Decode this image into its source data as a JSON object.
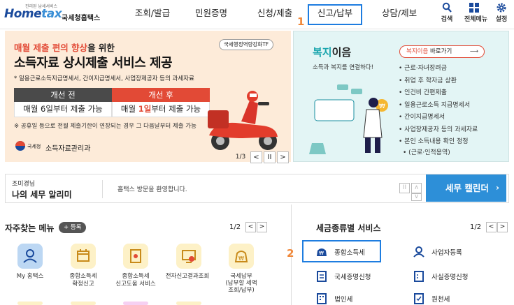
{
  "header": {
    "logo_tagline": "진리된 납세서비스",
    "logo_text_a": "Home",
    "logo_text_b": "tax",
    "logo_kr": "국세청홈택스",
    "nav": [
      "조회/발급",
      "민원증명",
      "신청/제출",
      "신고/납부",
      "상담/제보"
    ],
    "annotation_1": "1",
    "tools": [
      "검색",
      "전체메뉴",
      "설정"
    ]
  },
  "banner": {
    "subtitle_pre": "매월 제출 편의 향상",
    "subtitle_post": "을 위한",
    "title": "소득자료 상시제출 서비스 제공",
    "note": "* 일용근로소득지급명세서, 간이지급명세서, 사업장제공자 등의 과세자료",
    "badge": "국세행정역량강화TF",
    "before_label": "개선 전",
    "before_value": "매월 6일부터 제출 가능",
    "after_label": "개선 후",
    "after_value_pre": "매월 ",
    "after_value_hl": "1일",
    "after_value_post": "부터 제출 가능",
    "footnote": "※ 공휴일 등으로 전월 제출기한이 연장되는 경우 그 다음날부터 제출 가능",
    "org_logo": "국세청",
    "org": "소득자료관리과",
    "page": "1/3",
    "pager_prev": "<",
    "pager_pause": "II",
    "pager_next": ">"
  },
  "welfare": {
    "title_a": "복지",
    "title_b": "이음",
    "subtitle": "소득과 복지를 연결하다!",
    "button_a": "복지이음",
    "button_b": " 바로가기",
    "items": [
      "근로·자녀장려금",
      "취업 후 학자금 상환",
      "인건비 간편제출",
      "일용근로소득 지급명세서",
      "간이지급명세서",
      "사업장제공자 등의 과세자료",
      "본인 소득내용 확인 정정",
      "(근로·인적용역)"
    ]
  },
  "bulletin": {
    "greeting": "조미경님",
    "title": "나의 세무 알리미",
    "message": "홈택스 방문을 환영합니다.",
    "calendar_btn": "세무 캘린더"
  },
  "fav": {
    "title": "자주찾는 메뉴",
    "add_btn": "+ 등록",
    "page": "1/2",
    "items": [
      "My 홈택스",
      "종합소득세\n확정신고",
      "종합소득세\n신고도움 서비스",
      "전자신고결과조회",
      "국세납부\n(납부할 세액\n조회/납부)"
    ]
  },
  "taxsvc": {
    "title": "세금종류별 서비스",
    "page": "1/2",
    "annotation_2": "2",
    "items": [
      "종합소득세",
      "사업자등록",
      "국세증명신청",
      "사실증명신청",
      "법인세",
      "원천세"
    ]
  },
  "colors": {
    "brand": "#1a4a9c",
    "accent_red": "#e24a36",
    "highlight_blue": "#1e7de0",
    "annotation": "#f0883a"
  }
}
